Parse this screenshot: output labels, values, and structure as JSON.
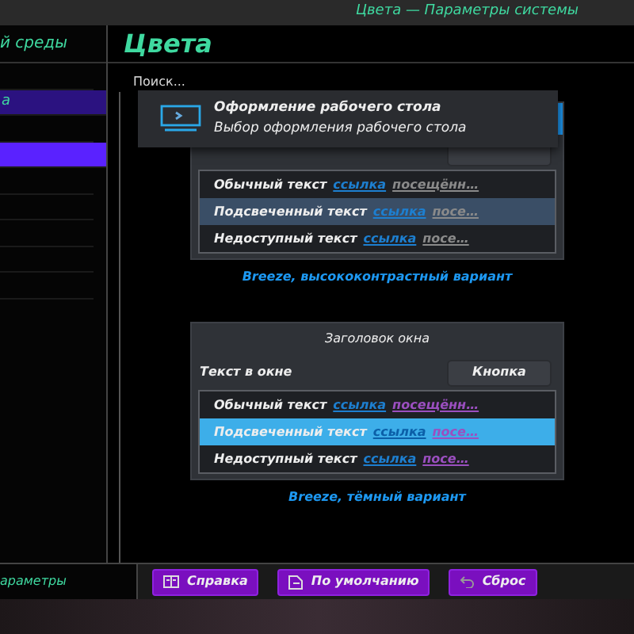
{
  "window": {
    "title": "Цвета — Параметры системы"
  },
  "sidebar": {
    "header": "й среды",
    "items": [
      {
        "selected": false,
        "hovered": false
      },
      {
        "label": "а",
        "selected": true,
        "hovered": false
      },
      {
        "selected": false,
        "hovered": false
      },
      {
        "selected": false,
        "hovered": true
      },
      {
        "selected": false,
        "hovered": false
      },
      {
        "selected": false,
        "hovered": false
      },
      {
        "selected": false,
        "hovered": false
      },
      {
        "selected": false,
        "hovered": false
      },
      {
        "selected": false,
        "hovered": false
      }
    ],
    "footer": "араметры"
  },
  "page": {
    "heading": "Цвета",
    "search": {
      "placeholder": "Поиск..."
    }
  },
  "tooltip": {
    "title": "Оформление рабочего стола",
    "subtitle": "Выбор оформления рабочего стола"
  },
  "schemes": [
    {
      "kind": "high_contrast",
      "selected": true,
      "caption": "Breeze, высококонтрастный вариант",
      "preview": {
        "rows": [
          {
            "text": "Обычный текст",
            "link": "ссылка",
            "visited": "посещённ…",
            "selected": false
          },
          {
            "text": "Подсвеченный текст",
            "link": "ссылка",
            "visited": "посе…",
            "selected": true
          },
          {
            "text": "Недоступный текст",
            "link": "ссылка",
            "visited": "посе…",
            "selected": false
          }
        ]
      }
    },
    {
      "kind": "dark",
      "selected": false,
      "caption": "Breeze, тёмный вариант",
      "preview": {
        "title": "Заголовок окна",
        "window_text": "Текст в окне",
        "button": "Кнопка",
        "rows": [
          {
            "text": "Обычный текст",
            "link": "ссылка",
            "visited": "посещённ…",
            "selected": false
          },
          {
            "text": "Подсвеченный текст",
            "link": "ссылка",
            "visited": "посе…",
            "selected": true
          },
          {
            "text": "Недоступный текст",
            "link": "ссылка",
            "visited": "посе…",
            "selected": false
          }
        ]
      }
    }
  ],
  "buttons": [
    {
      "label": "Справка",
      "kind": "help"
    },
    {
      "label": "По умолчанию",
      "kind": "defaults"
    },
    {
      "label": "Сброс",
      "kind": "reset"
    }
  ]
}
